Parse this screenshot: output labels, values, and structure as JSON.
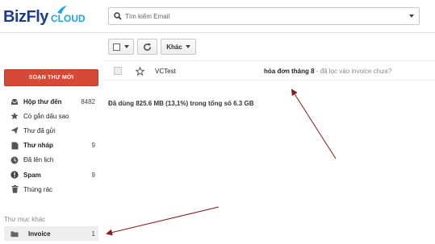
{
  "brand": {
    "name_part1": "BizFly",
    "name_part2": "CLOUD"
  },
  "search": {
    "placeholder": "Tìm kiếm Email",
    "icon": "search-icon"
  },
  "toolbar": {
    "more_label": "Khác"
  },
  "compose": {
    "label": "SOẠN THƯ MỚI"
  },
  "sidebar": {
    "items": [
      {
        "label": "Hộp thư đến",
        "count": "8482",
        "icon": "inbox-icon",
        "bold": true
      },
      {
        "label": "Có gắn dấu sao",
        "count": "",
        "icon": "star-icon",
        "bold": false
      },
      {
        "label": "Thư đã gửi",
        "count": "",
        "icon": "send-icon",
        "bold": false
      },
      {
        "label": "Thư nháp",
        "count": "9",
        "icon": "draft-icon",
        "bold": true
      },
      {
        "label": "Đã lên lịch",
        "count": "",
        "icon": "clock-icon",
        "bold": false
      },
      {
        "label": "Spam",
        "count": "9",
        "icon": "spam-icon",
        "bold": true
      },
      {
        "label": "Thùng rác",
        "count": "",
        "icon": "trash-icon",
        "bold": false
      }
    ],
    "other_folders_label": "Thư mục khác",
    "folders": [
      {
        "label": "Invoice",
        "count": "1",
        "icon": "folder-icon"
      }
    ]
  },
  "mail_list": [
    {
      "sender": "VCTest",
      "subject": "hóa đơn tháng 8",
      "snippet": " - đã lọc vào invoice chưa?"
    }
  ],
  "usage_text": "Đã dùng 825.6 MB (13,1%) trong tổng số 6.3 GB",
  "colors": {
    "compose_bg": "#d64937",
    "brand_dark": "#1f3c88",
    "brand_light": "#1aa6e0",
    "annotation_arrow": "#8b1a1a"
  }
}
